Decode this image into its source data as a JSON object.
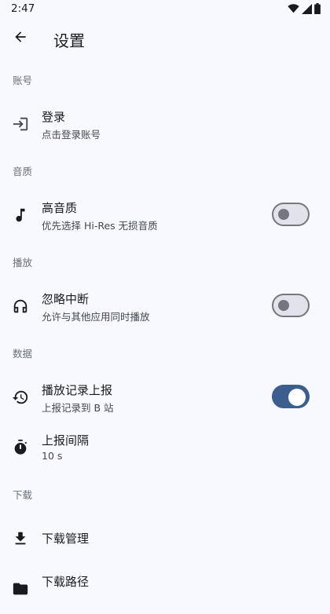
{
  "status_bar": {
    "time": "2:47"
  },
  "app_bar": {
    "title": "设置"
  },
  "sections": {
    "account": {
      "header": "账号",
      "login": {
        "title": "登录",
        "summary": "点击登录账号"
      }
    },
    "quality": {
      "header": "音质",
      "hires": {
        "title": "高音质",
        "summary": "优先选择 Hi-Res 无损音质",
        "enabled": false
      }
    },
    "playback": {
      "header": "播放",
      "ignore_interrupt": {
        "title": "忽略中断",
        "summary": "允许与其他应用同时播放",
        "enabled": false
      }
    },
    "data": {
      "header": "数据",
      "report_history": {
        "title": "播放记录上报",
        "summary": "上报记录到 B 站",
        "enabled": true
      },
      "report_interval": {
        "title": "上报间隔",
        "summary": "10 s"
      }
    },
    "download": {
      "header": "下载",
      "manage": {
        "title": "下载管理"
      },
      "path": {
        "title": "下载路径"
      }
    }
  },
  "colors": {
    "background": "#f8f9ff",
    "accent": "#3b5d8f",
    "switch_off": "#74777f"
  }
}
